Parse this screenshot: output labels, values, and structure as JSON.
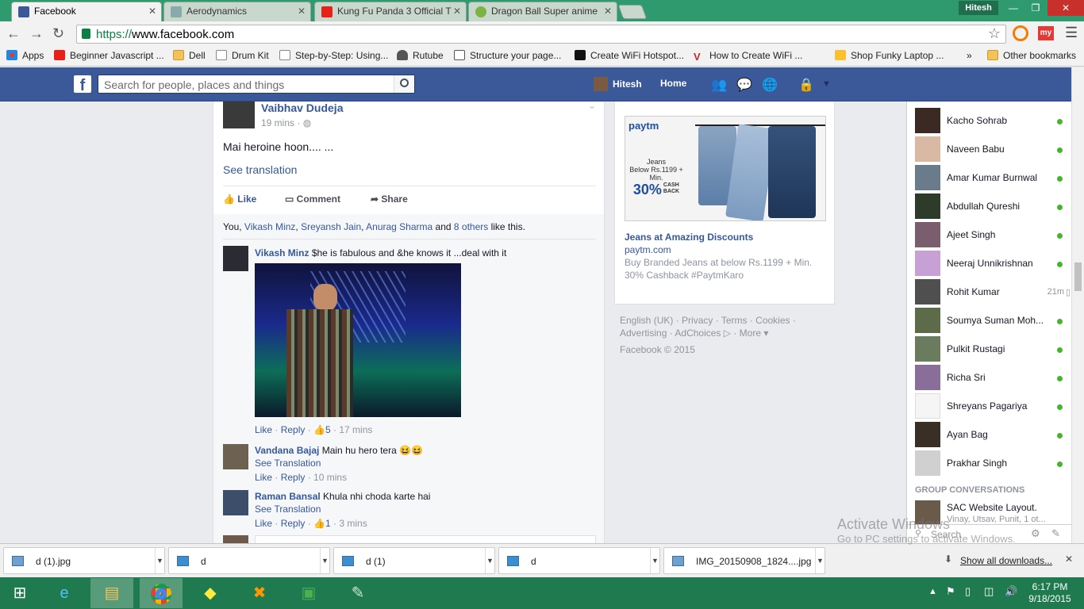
{
  "browser": {
    "tabs": [
      {
        "title": "Facebook",
        "active": true,
        "icon": "facebook-icon"
      },
      {
        "title": "Aerodynamics",
        "active": false,
        "icon": "site-icon"
      },
      {
        "title": "Kung Fu Panda 3 Official T",
        "active": false,
        "icon": "youtube-icon"
      },
      {
        "title": "Dragon Ball Super anime",
        "active": false,
        "icon": "dragonball-icon"
      }
    ],
    "profile_name": "Hitesh",
    "url_scheme": "https://",
    "url_rest": "www.facebook.com",
    "bookmarks": [
      {
        "label": "Apps",
        "icon": "apps-grid-icon"
      },
      {
        "label": "Beginner Javascript ...",
        "icon": "youtube-icon"
      },
      {
        "label": "Dell",
        "icon": "folder-icon"
      },
      {
        "label": "Drum Kit",
        "icon": "page-icon"
      },
      {
        "label": "Step-by-Step: Using...",
        "icon": "page-icon"
      },
      {
        "label": "Rutube",
        "icon": "rutube-icon"
      },
      {
        "label": "Structure your page...",
        "icon": "page-icon"
      },
      {
        "label": "Create WiFi Hotspot...",
        "icon": "f-icon"
      },
      {
        "label": "How to Create WiFi ...",
        "icon": "v-icon"
      },
      {
        "label": "Shop Funky Laptop ...",
        "icon": "shop-icon"
      }
    ],
    "bookmarks_more": "»",
    "other_bookmarks": "Other bookmarks"
  },
  "fb_header": {
    "logo": "f",
    "search_placeholder": "Search for people, places and things",
    "user_name": "Hitesh",
    "home_label": "Home"
  },
  "post": {
    "author": "Vaibhav Dudeja",
    "time": "19 mins · ",
    "text": "Mai heroine hoon.... ...",
    "see_translation": "See translation",
    "actions": {
      "like": "Like",
      "comment": "Comment",
      "share": "Share"
    },
    "likes_prefix": "You, ",
    "likes_names": [
      "Vikash Minz",
      "Sreyansh Jain",
      "Anurag Sharma"
    ],
    "likes_and": " and ",
    "likes_others": "8 others",
    "likes_suffix": " like this."
  },
  "comments": [
    {
      "author": "Vikash Minz",
      "text": "$he is fabulous and &he knows it ...deal with it",
      "like": "Like",
      "reply": "Reply",
      "likes_count": "5",
      "time": "17 mins",
      "has_photo": true,
      "see_translation": ""
    },
    {
      "author": "Vandana Bajaj",
      "text": "Main hu hero tera 😆😆",
      "see_translation": "See Translation",
      "like": "Like",
      "reply": "Reply",
      "time": "10 mins"
    },
    {
      "author": "Raman Bansal",
      "text": "Khula nhi choda karte hai",
      "see_translation": "See Translation",
      "like": "Like",
      "reply": "Reply",
      "likes_count": "1",
      "time": "3 mins"
    }
  ],
  "ad": {
    "brand": "paytm",
    "image_text": {
      "jeans": "Jeans",
      "below": "Below Rs.1199 +",
      "min": "Min.",
      "percent": "30%",
      "cash": "CASH",
      "back": "BACK"
    },
    "title": "Jeans at Amazing Discounts",
    "domain": "paytm.com",
    "desc": "Buy Branded Jeans at below Rs.1199 + Min. 30% Cashback #PaytmKaro"
  },
  "footer_links": {
    "line1": [
      "English (UK)",
      "Privacy",
      "Terms",
      "Cookies"
    ],
    "line2": [
      "Advertising",
      "AdChoices",
      "More"
    ],
    "copyright": "Facebook © 2015"
  },
  "chat": {
    "contacts": [
      {
        "name": "Kacho Sohrab",
        "status": "online"
      },
      {
        "name": "Naveen Babu",
        "status": "online"
      },
      {
        "name": "Amar Kumar Burnwal",
        "status": "online"
      },
      {
        "name": "Abdullah Qureshi",
        "status": "online"
      },
      {
        "name": "Ajeet Singh",
        "status": "online"
      },
      {
        "name": "Neeraj Unnikrishnan",
        "status": "online"
      },
      {
        "name": "Rohit Kumar",
        "status": "mobile",
        "time": "21m"
      },
      {
        "name": "Soumya Suman Moh...",
        "status": "online"
      },
      {
        "name": "Pulkit Rustagi",
        "status": "online"
      },
      {
        "name": "Richa Sri",
        "status": "online"
      },
      {
        "name": "Shreyans Pagariya",
        "status": "online"
      },
      {
        "name": "Ayan Bag",
        "status": "online"
      },
      {
        "name": "Prakhar Singh",
        "status": "online"
      }
    ],
    "group_heading": "GROUP CONVERSATIONS",
    "group_name": "SAC Website Layout.",
    "group_members": "Vinay, Utsav, Punit, 1 ot...",
    "search_placeholder": "Search"
  },
  "downloads": [
    {
      "name": "d (1).jpg"
    },
    {
      "name": "d"
    },
    {
      "name": "d (1)"
    },
    {
      "name": "d"
    },
    {
      "name": "IMG_20150908_1824....jpg"
    }
  ],
  "show_all_downloads": "Show all downloads...",
  "watermark": {
    "line1": "Activate Windows",
    "line2": "Go to PC settings to activate Windows."
  },
  "clock": {
    "time": "6:17 PM",
    "date": "9/18/2015"
  },
  "colors": {
    "fb_blue": "#3b5998",
    "link": "#365899",
    "online": "#42b72a",
    "taskbar": "#1f7a4f",
    "tabbar": "#2f9a6e"
  }
}
